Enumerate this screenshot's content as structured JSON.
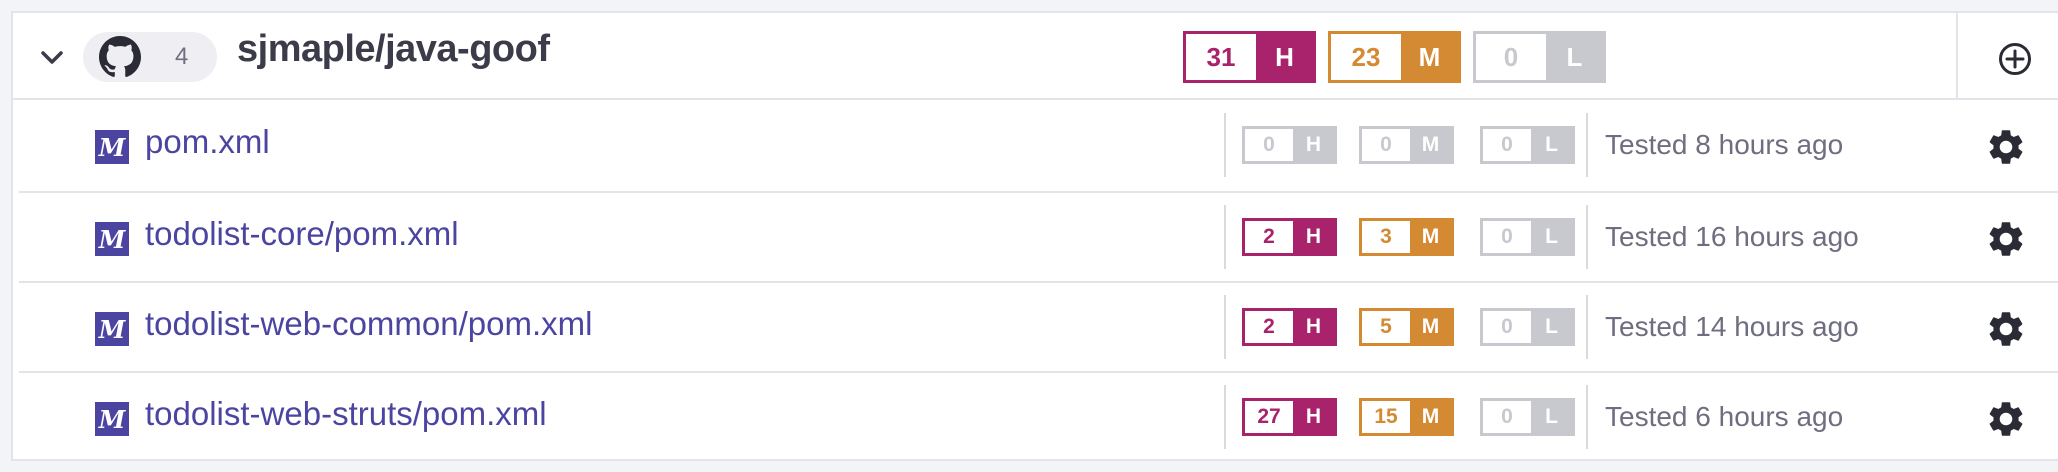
{
  "project": {
    "name": "sjmaple/java-goof",
    "target_count": "4",
    "high": "31",
    "medium": "23",
    "low": "0",
    "high_label": "H",
    "medium_label": "M",
    "low_label": "L",
    "icons": {
      "collapse": "chevron-down-icon",
      "repo": "github-icon",
      "add": "plus-circle-icon"
    }
  },
  "colors": {
    "high": "#a8236b",
    "medium": "#d48a32",
    "low": "#c8c8cf",
    "link": "#4b45a1"
  },
  "targets": [
    {
      "icon": "maven-icon",
      "icon_text": "M",
      "file": "pom.xml",
      "high": "0",
      "medium": "0",
      "low": "0",
      "tested": "Tested 8 hours ago",
      "high_active": false,
      "medium_active": false
    },
    {
      "icon": "maven-icon",
      "icon_text": "M",
      "file": "todolist-core/pom.xml",
      "high": "2",
      "medium": "3",
      "low": "0",
      "tested": "Tested 16 hours ago",
      "high_active": true,
      "medium_active": true
    },
    {
      "icon": "maven-icon",
      "icon_text": "M",
      "file": "todolist-web-common/pom.xml",
      "high": "2",
      "medium": "5",
      "low": "0",
      "tested": "Tested 14 hours ago",
      "high_active": true,
      "medium_active": true
    },
    {
      "icon": "maven-icon",
      "icon_text": "M",
      "file": "todolist-web-struts/pom.xml",
      "high": "27",
      "medium": "15",
      "low": "0",
      "tested": "Tested 6 hours ago",
      "high_active": true,
      "medium_active": true
    }
  ]
}
